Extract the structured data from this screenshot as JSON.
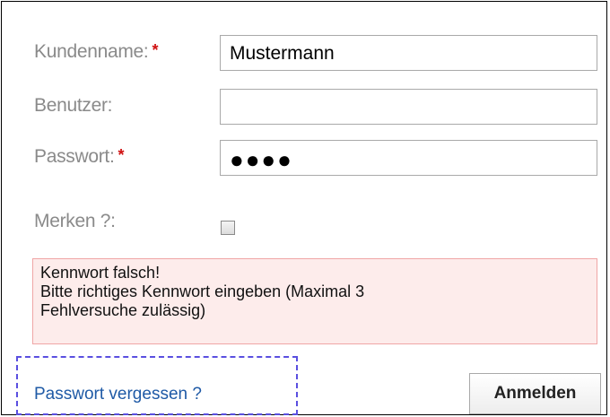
{
  "form": {
    "customer_label": "Kundenname:",
    "customer_value": "Mustermann",
    "user_label": "Benutzer:",
    "user_value": "",
    "password_label": "Passwort:",
    "password_mask": "●●●●",
    "required_marker": "*",
    "remember_label": "Merken ?:",
    "remember_checked": false
  },
  "error": {
    "line1": "Kennwort falsch!",
    "line2": "Bitte richtiges Kennwort eingeben (Maximal 3",
    "line3": "Fehlversuche zulässig)"
  },
  "footer": {
    "forgot_label": "Passwort vergessen ?",
    "submit_label": "Anmelden"
  },
  "colors": {
    "required": "#d01010",
    "error_bg": "#fdeceb",
    "error_border": "#f0a6a6",
    "link": "#1f5aa6",
    "focus_outline": "#5a4fe0"
  }
}
